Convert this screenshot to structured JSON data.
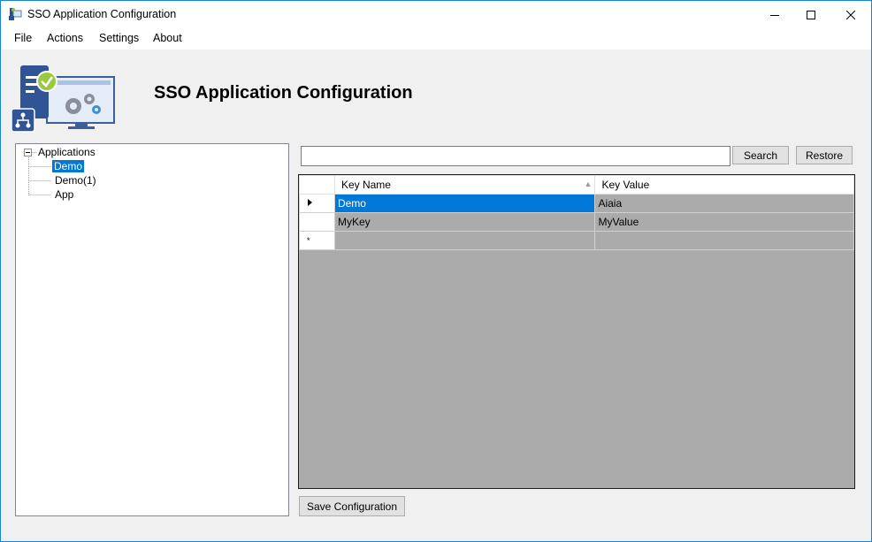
{
  "window": {
    "title": "SSO Application Configuration",
    "minimize_icon": "minimize-icon",
    "maximize_icon": "maximize-icon",
    "close_icon": "close-icon"
  },
  "menu": [
    "File",
    "Actions",
    "Settings",
    "About"
  ],
  "banner": {
    "title": "SSO Application Configuration",
    "logo_icon": "sso-config-logo"
  },
  "tree": {
    "root": "Applications",
    "items": [
      "Demo",
      "Demo(1)",
      "App"
    ],
    "selected": "Demo"
  },
  "search": {
    "value": "",
    "search_label": "Search",
    "restore_label": "Restore"
  },
  "grid": {
    "columns": [
      "Key Name",
      "Key Value"
    ],
    "sorted_column": "Key Name",
    "rows": [
      {
        "key": "Demo",
        "value": "Aiaia",
        "current": true
      },
      {
        "key": "MyKey",
        "value": "MyValue",
        "current": false
      }
    ],
    "new_row_marker": "*"
  },
  "footer": {
    "save_label": "Save Configuration"
  },
  "colors": {
    "accent": "#0078d7",
    "grid_background": "#ababab",
    "window_border": "#1883d7"
  }
}
